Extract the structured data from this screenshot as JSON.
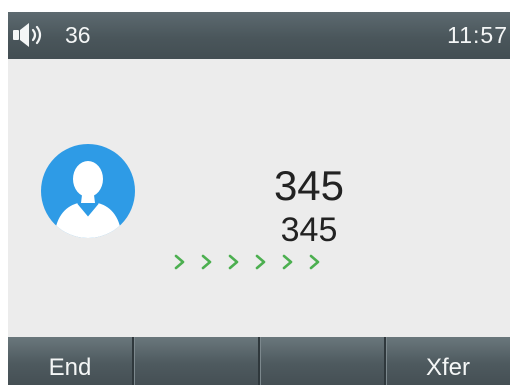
{
  "status_bar": {
    "speaker_icon": "speaker-icon",
    "account": "36",
    "time": "11:57"
  },
  "call": {
    "avatar_icon": "person-avatar-icon",
    "name": "345",
    "number": "345",
    "progress_icon": "chevron-right-icon",
    "progress_count": 6,
    "progress_color": "#4caf50"
  },
  "softkeys": [
    {
      "label": "End"
    },
    {
      "label": ""
    },
    {
      "label": ""
    },
    {
      "label": "Xfer"
    }
  ],
  "colors": {
    "status_bar": "#4a565b",
    "background": "#ececec",
    "avatar": "#2e9be6",
    "softkey_bar": "#4e5a5f"
  }
}
